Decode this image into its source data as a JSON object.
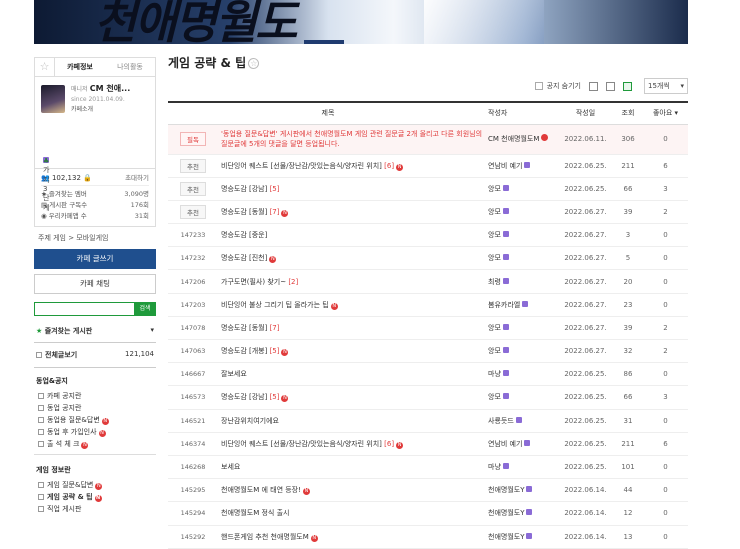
{
  "banner": {
    "text": "천애명월도"
  },
  "sidebar": {
    "tabs": [
      "카페정보",
      "나의활동"
    ],
    "cafe": {
      "manager": "매니저",
      "name": "CM 천애...",
      "since": "since 2011.04.09.",
      "intro": "카페소개",
      "level": "가지3단계"
    },
    "members": {
      "count": "102,132",
      "invite": "초대하기"
    },
    "stats": [
      {
        "label": "즐겨찾는 멤버",
        "value": "3,090명"
      },
      {
        "label": "게시판 구독수",
        "value": "176회"
      },
      {
        "label": "우리카페앱 수",
        "value": "31회"
      }
    ],
    "breadcrumb": "주제 게임 > 모바일게임",
    "write_button": "카페 글쓰기",
    "chat_button": "카페 채팅",
    "search_button": "검색",
    "favorites": "즐겨찾는 게시판",
    "all_posts": {
      "label": "전체글보기",
      "count": "121,104"
    },
    "groups": [
      {
        "title": "동업&공지",
        "items": [
          {
            "label": "카페 공지란",
            "new": false
          },
          {
            "label": "동업 공지란",
            "new": false
          },
          {
            "label": "동업용 질문&답변",
            "new": true
          },
          {
            "label": "동업 후 가입인사",
            "new": true
          },
          {
            "label": "출 석 체 크",
            "new": true
          }
        ]
      },
      {
        "title": "게임 정보란",
        "items": [
          {
            "label": "게임 질문&답변",
            "new": true
          },
          {
            "label": "게임 공략 & 팁",
            "new": true
          },
          {
            "label": "직업 게시판",
            "new": false
          }
        ]
      }
    ]
  },
  "main": {
    "title": "게임 공략 & 팁",
    "hide_notice": "공지 숨기기",
    "per_page": "15개씩",
    "columns": [
      "제목",
      "작성자",
      "작성일",
      "조회",
      "좋아요"
    ],
    "rows": [
      {
        "id": "필독",
        "tag": "red",
        "title": "'동업용 질문&답변' 게시판에서 천애명월도M 게임 관련 질문글 2개 올리고 다른 회원님의 질문글에 5개의 댓글을 달면 등업됩니다.",
        "author": "CM 천애명월도M",
        "date": "2022.06.11.",
        "views": "306",
        "likes": "0",
        "notice": true
      },
      {
        "id": "추천",
        "tag": "gray",
        "title": "비단잉어 퀘스트 [선물/장난감/맛있는음식/양자린 위치]",
        "cmt": "[6]",
        "author": "연남비 예기",
        "date": "2022.06.25.",
        "views": "211",
        "likes": "6"
      },
      {
        "id": "추천",
        "tag": "gray",
        "title": "명승도감 [강남]",
        "cmt": "[5]",
        "author": "앙모",
        "date": "2022.06.25.",
        "views": "66",
        "likes": "3"
      },
      {
        "id": "추천",
        "tag": "gray",
        "title": "명승도감 [동월]",
        "cmt": "[7]",
        "author": "앙모",
        "date": "2022.06.27.",
        "views": "39",
        "likes": "2"
      },
      {
        "id": "147233",
        "title": "명승도감 [중운]",
        "cmt": "",
        "author": "앙모",
        "date": "2022.06.27.",
        "views": "3",
        "likes": "0"
      },
      {
        "id": "147232",
        "title": "명승도감 [진천]",
        "cmt": "",
        "author": "앙모",
        "date": "2022.06.27.",
        "views": "5",
        "likes": "0"
      },
      {
        "id": "147206",
        "title": "가구도면(필사) 찾기~",
        "cmt": "[2]",
        "author": "최령",
        "date": "2022.06.27.",
        "views": "20",
        "likes": "0"
      },
      {
        "id": "147203",
        "title": "비단잉어 불상 그리기 팁 올라가는 팁",
        "cmt": "",
        "author": "봄유카라엘",
        "date": "2022.06.27.",
        "views": "23",
        "likes": "0"
      },
      {
        "id": "147078",
        "title": "명승도감 [동월]",
        "cmt": "[7]",
        "author": "앙모",
        "date": "2022.06.27.",
        "views": "39",
        "likes": "2"
      },
      {
        "id": "147063",
        "title": "명승도감 [개봉]",
        "cmt": "[5]",
        "author": "앙모",
        "date": "2022.06.27.",
        "views": "32",
        "likes": "2"
      },
      {
        "id": "146667",
        "title": "잘보세요",
        "cmt": "",
        "author": "마냥",
        "date": "2022.06.25.",
        "views": "86",
        "likes": "0"
      },
      {
        "id": "146573",
        "title": "명승도감 [강남]",
        "cmt": "[5]",
        "author": "앙모",
        "date": "2022.06.25.",
        "views": "66",
        "likes": "3"
      },
      {
        "id": "146521",
        "title": "장난감위치여기에요",
        "cmt": "",
        "author": "사룡듯드",
        "date": "2022.06.25.",
        "views": "31",
        "likes": "0"
      },
      {
        "id": "146374",
        "title": "비단잉어 퀘스트 [선물/장난감/맛있는음식/양자린 위치]",
        "cmt": "[6]",
        "author": "연남비 예기",
        "date": "2022.06.25.",
        "views": "211",
        "likes": "6"
      },
      {
        "id": "146268",
        "title": "보세요",
        "cmt": "",
        "author": "마냥",
        "date": "2022.06.25.",
        "views": "101",
        "likes": "0"
      },
      {
        "id": "145295",
        "title": "천애명월도M 에 태연 등장!",
        "cmt": "",
        "author": "천애명월도Y",
        "date": "2022.06.14.",
        "views": "44",
        "likes": "0"
      },
      {
        "id": "145294",
        "title": "천애명월도M 정식 출시",
        "cmt": "",
        "author": "천애명월도Y",
        "date": "2022.06.14.",
        "views": "12",
        "likes": "0"
      },
      {
        "id": "145292",
        "title": "핸드폰게임 추천 천애명월도M",
        "cmt": "",
        "author": "천애명월도Y",
        "date": "2022.06.14.",
        "views": "13",
        "likes": "0"
      }
    ]
  }
}
